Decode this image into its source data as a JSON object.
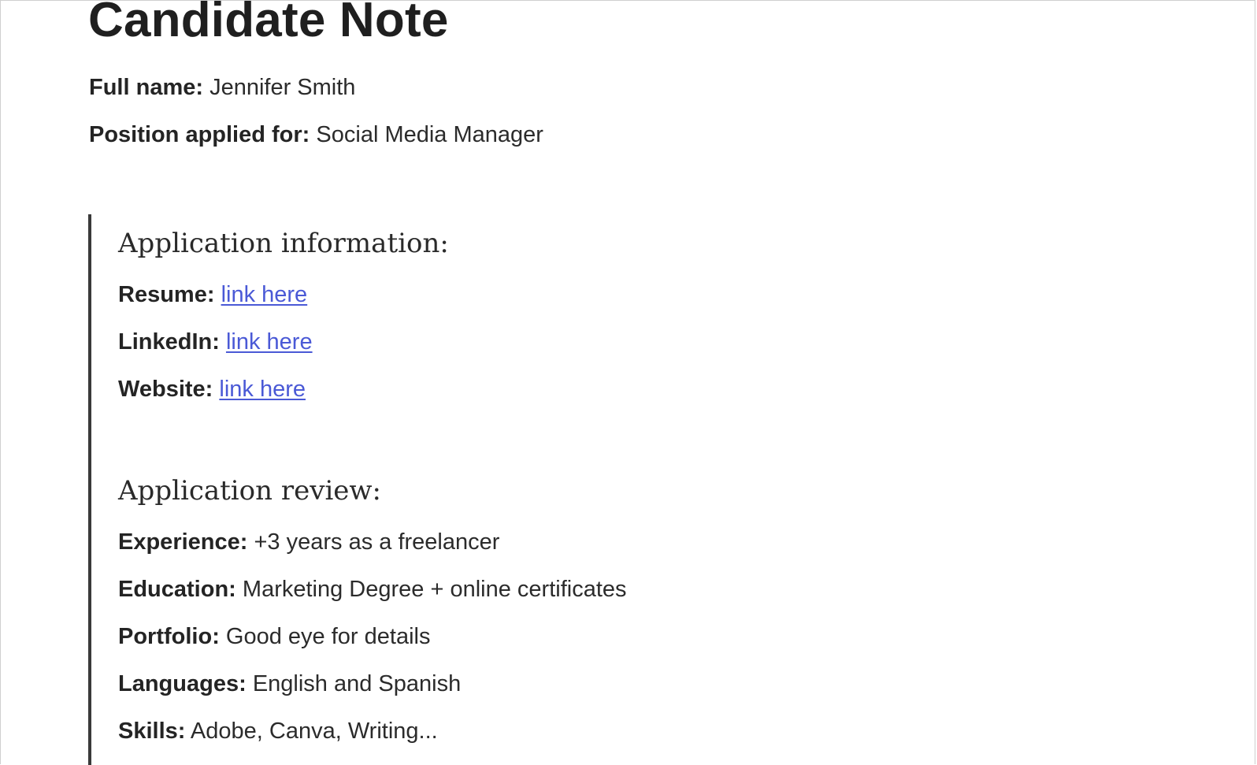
{
  "title": "Candidate Note",
  "candidate": {
    "full_name_label": "Full name:",
    "full_name": "Jennifer Smith",
    "position_label": "Position applied for:",
    "position": "Social Media Manager"
  },
  "application_information": {
    "heading": "Application information:",
    "resume_label": "Resume:",
    "resume_link": "link here",
    "linkedin_label": "LinkedIn:",
    "linkedin_link": "link here",
    "website_label": "Website:",
    "website_link": "link here"
  },
  "application_review": {
    "heading": "Application review:",
    "experience_label": "Experience:",
    "experience": "+3 years as a freelancer",
    "education_label": "Education:",
    "education": "Marketing Degree + online certificates",
    "portfolio_label": "Portfolio:",
    "portfolio": "Good eye for details",
    "languages_label": "Languages:",
    "languages": "English and Spanish",
    "skills_label": "Skills:",
    "skills": "Adobe, Canva, Writing..."
  },
  "colors": {
    "link": "#4a59d6",
    "quote_bar": "#3a3a3a",
    "text": "#2b2b2b"
  }
}
